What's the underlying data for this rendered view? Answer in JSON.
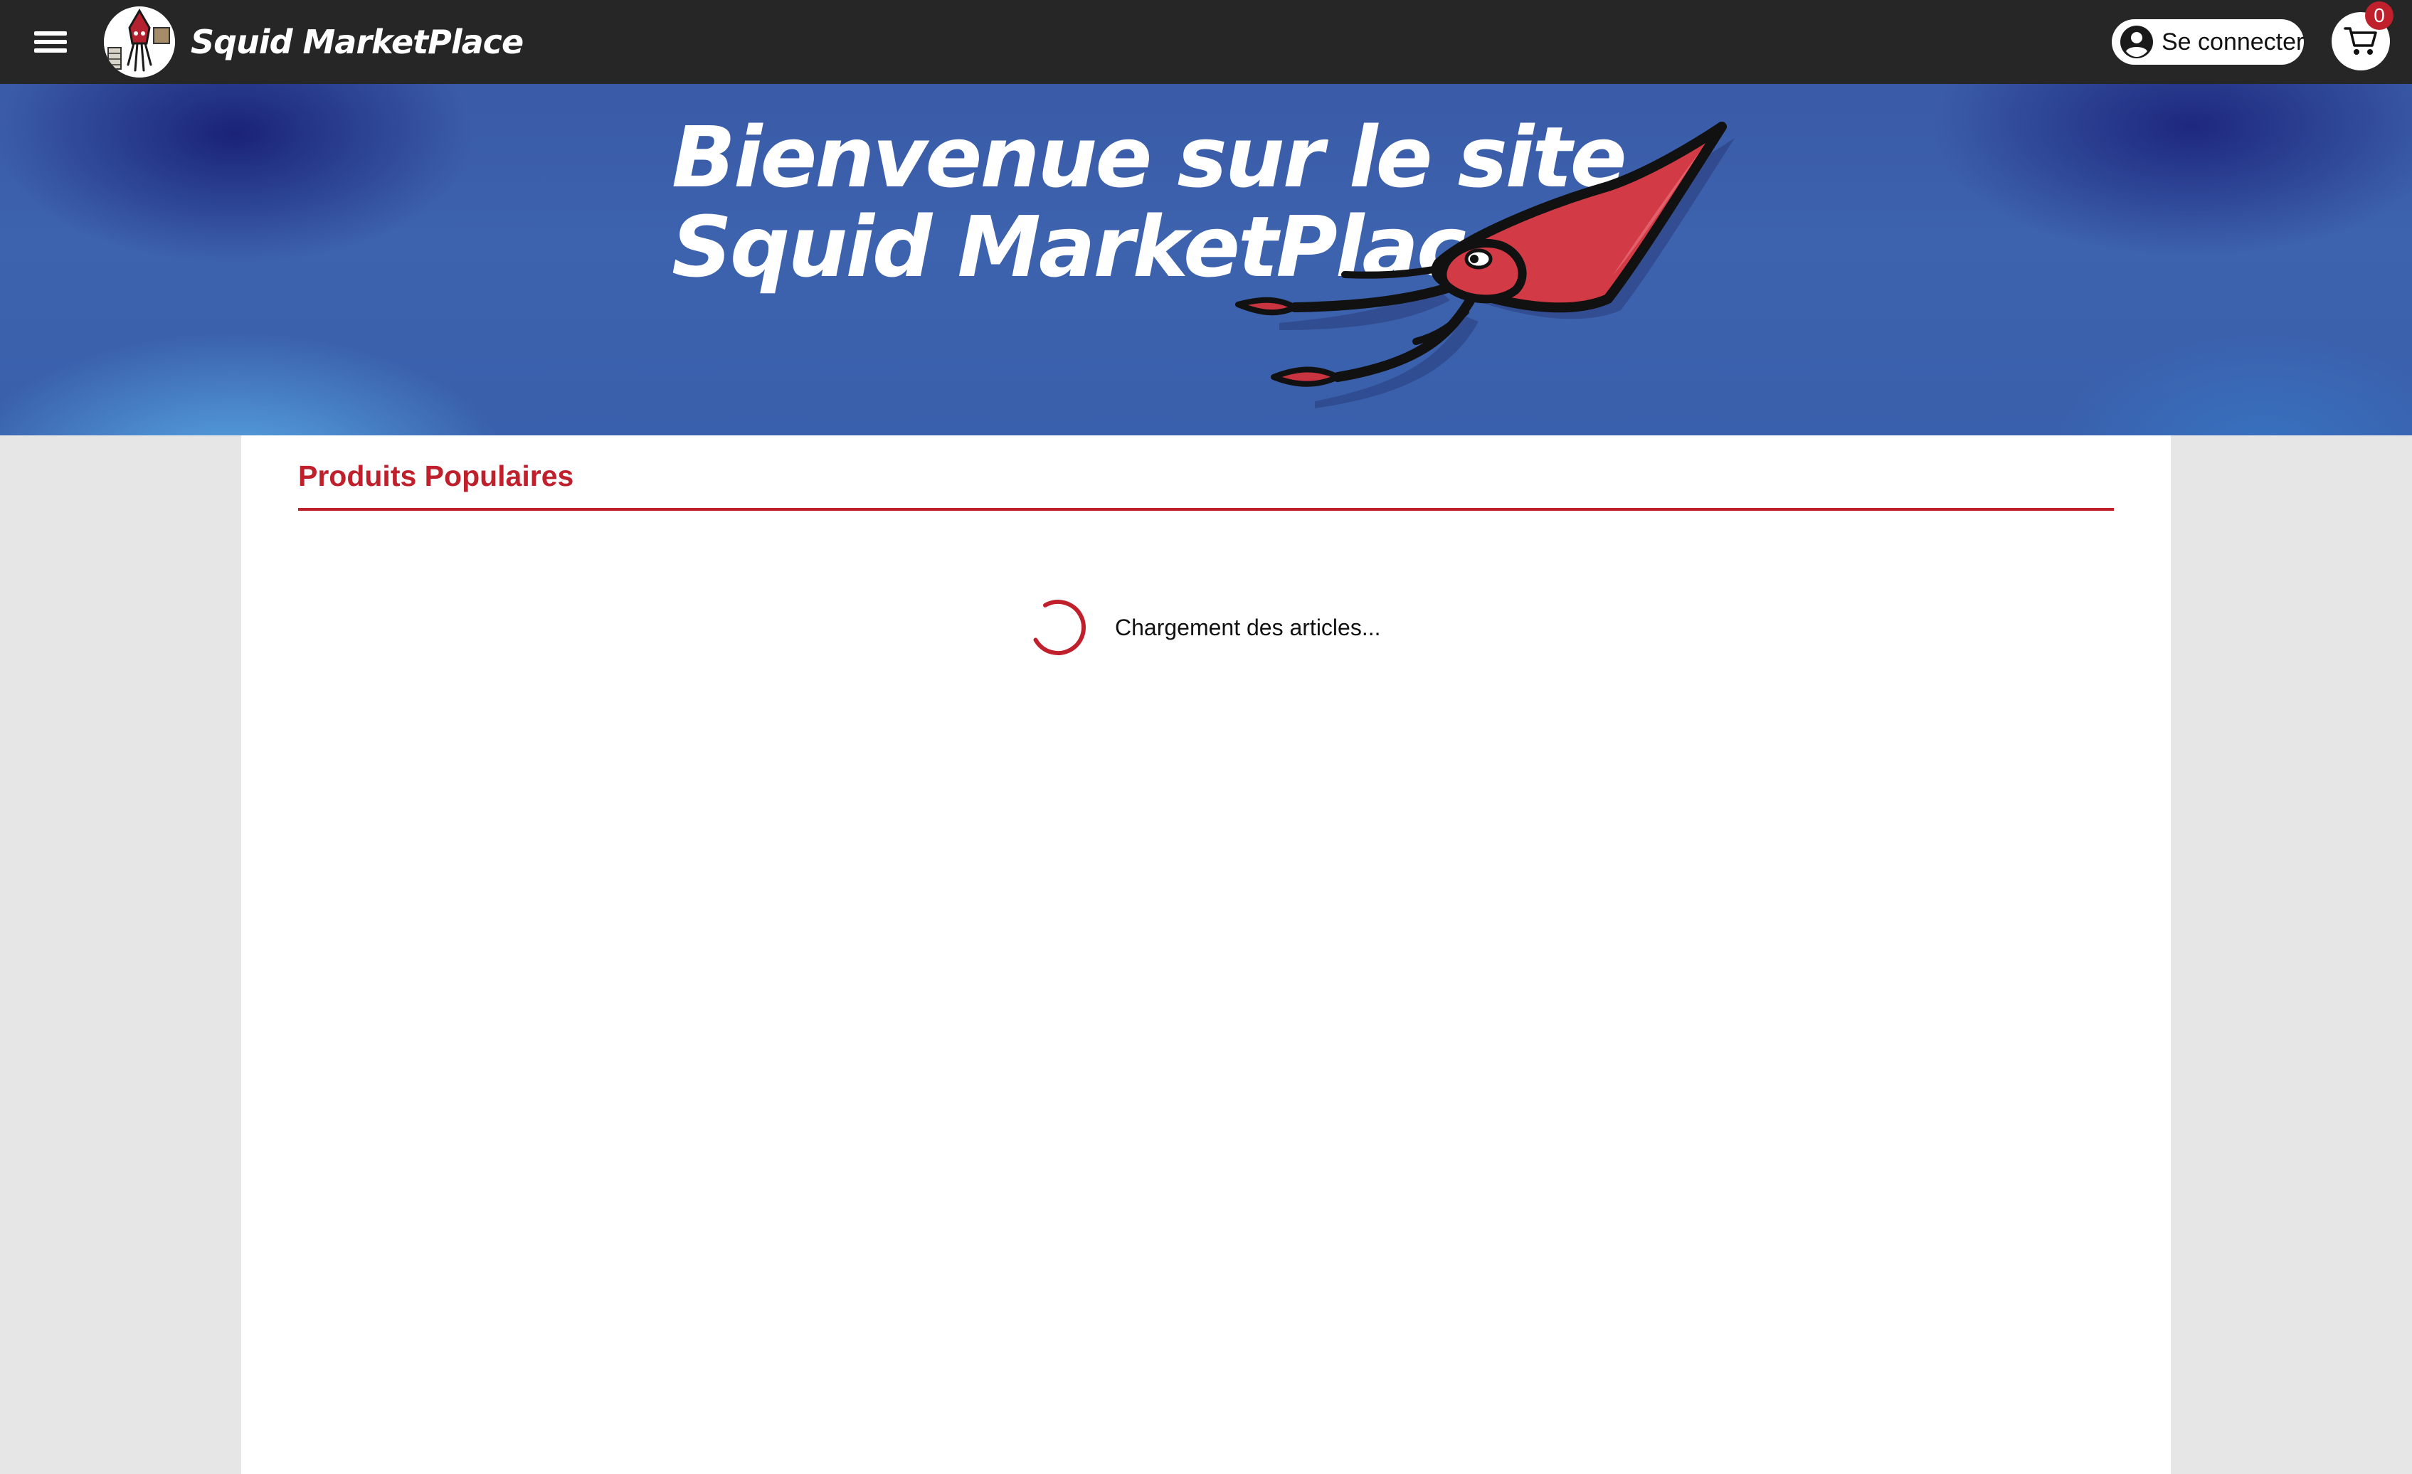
{
  "header": {
    "brand_name": "Squid MarketPlace",
    "menu_icon": "hamburger-menu-icon",
    "login_label": "Se connecter",
    "login_icon": "user-circle-icon",
    "cart_icon": "shopping-cart-icon",
    "cart_count": "0"
  },
  "hero": {
    "title_line1": "Bienvenue sur le site",
    "title_line2": "Squid MarketPlace",
    "illustration": "red-squid-illustration"
  },
  "main": {
    "section_title": "Produits Populaires",
    "loading_text": "Chargement des articles...",
    "loading_icon": "spinner-icon"
  },
  "colors": {
    "topbar": "#262626",
    "accent": "#c0202c",
    "hero_blue": "#3a5ba7",
    "page_background": "#e6e6e6",
    "content_background": "#ffffff"
  }
}
